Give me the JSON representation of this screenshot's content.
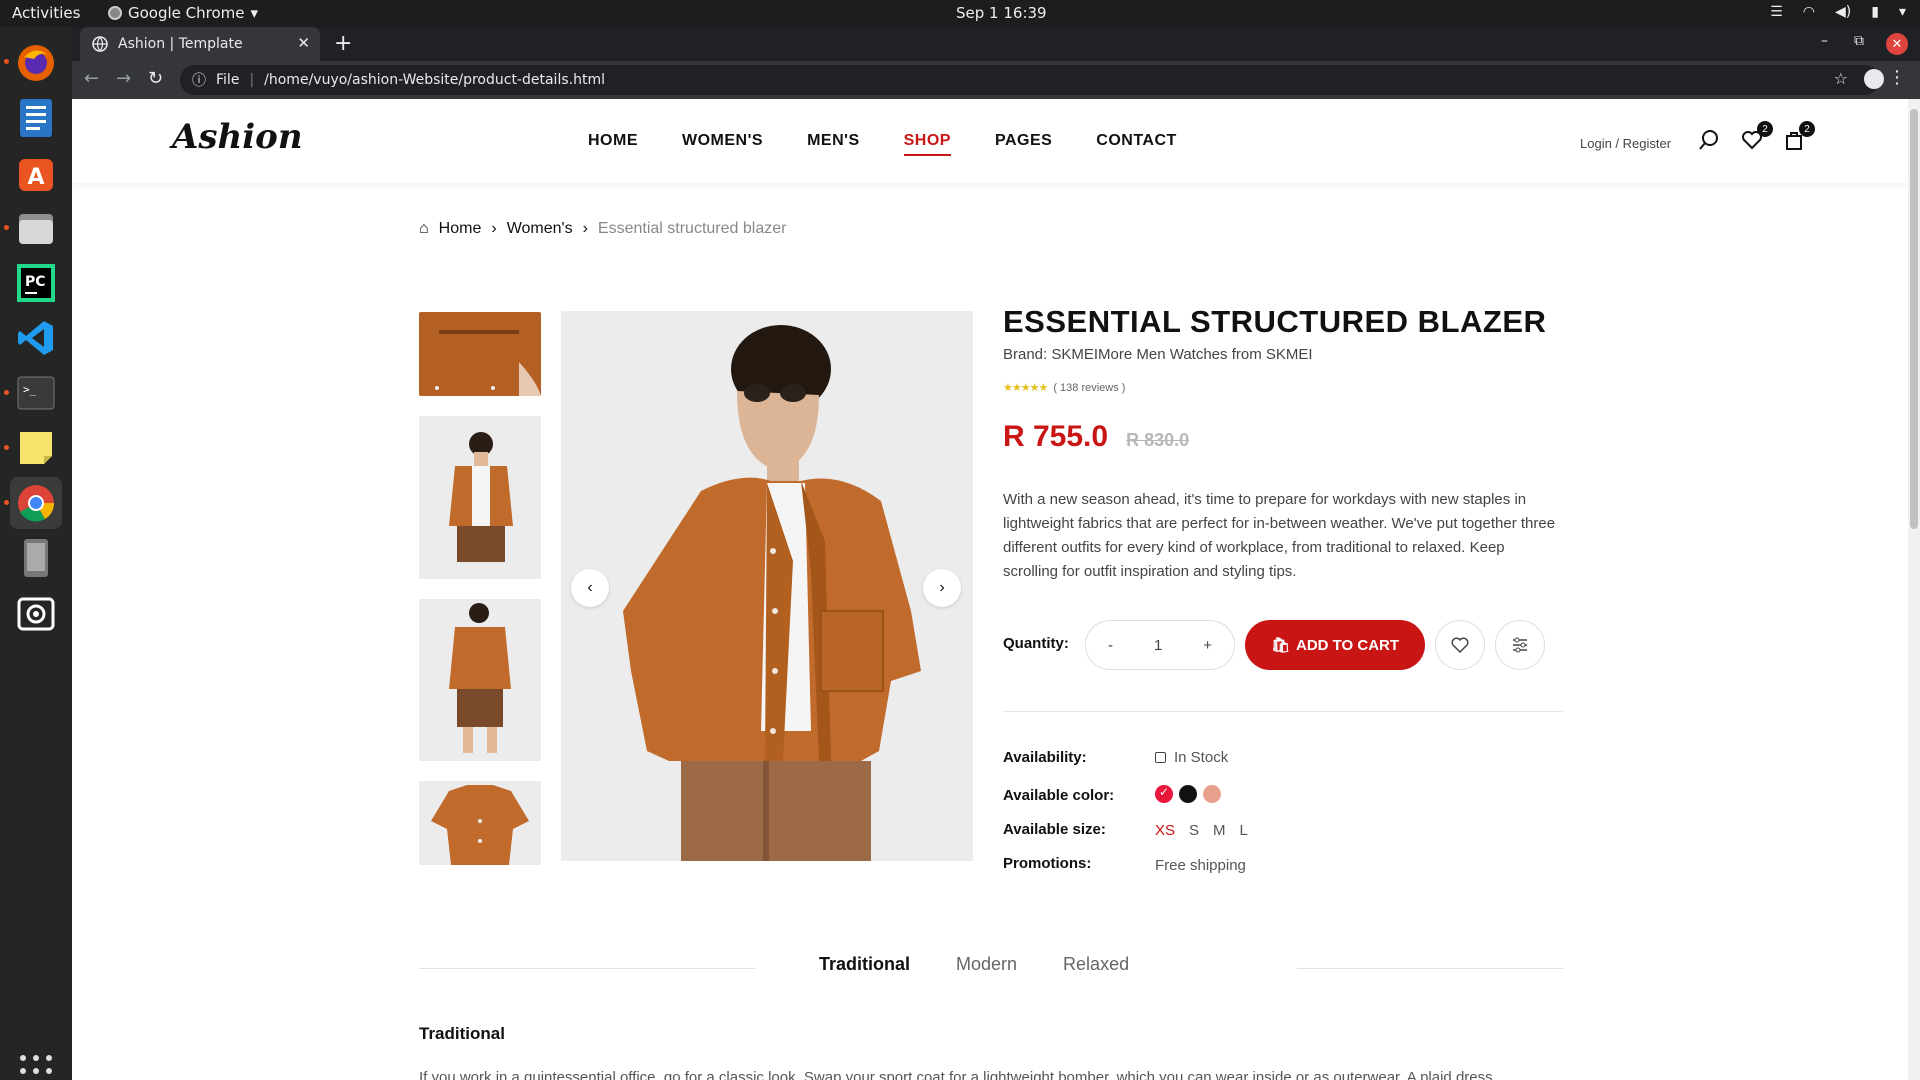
{
  "system": {
    "activities": "Activities",
    "app_name": "Google Chrome",
    "clock": "Sep 1  16:39"
  },
  "browser": {
    "tab_title": "Ashion | Template",
    "url_scheme": "File",
    "url": "/home/vuyo/ashion-Website/product-details.html"
  },
  "site": {
    "logo": "Ashion",
    "nav": [
      "HOME",
      "WOMEN'S",
      "MEN'S",
      "SHOP",
      "PAGES",
      "CONTACT"
    ],
    "nav_active": "SHOP",
    "auth": "Login / Register",
    "wishlist_count": "2",
    "cart_count": "2"
  },
  "breadcrumb": {
    "home": "Home",
    "category": "Women's",
    "current": "Essential structured blazer"
  },
  "product": {
    "title": "ESSENTIAL STRUCTURED BLAZER",
    "brand": "Brand: SKMEIMore Men Watches from SKMEI",
    "reviews": "( 138 reviews )",
    "rating": 5,
    "price": "R 755.0",
    "old_price": "R 830.0",
    "description": "With a new season ahead, it's time to prepare for workdays with new staples in lightweight fabrics that are perfect for in-between weather. We've put together three different outfits for every kind of workplace, from traditional to relaxed. Keep scrolling for outfit inspiration and styling tips.",
    "quantity_label": "Quantity:",
    "qty_minus": "-",
    "quantity": "1",
    "qty_plus": "+",
    "add_to_cart": "ADD TO CART",
    "availability_label": "Availability:",
    "availability": "In Stock",
    "color_label": "Available color:",
    "colors": [
      "#e8163b",
      "#111111",
      "#e7a08c"
    ],
    "size_label": "Available size:",
    "sizes": [
      "XS",
      "S",
      "M",
      "L"
    ],
    "selected_size": "XS",
    "promotions_label": "Promotions:",
    "promotions": "Free shipping",
    "shirt_color": "#c06a2b"
  },
  "tabs": {
    "items": [
      "Traditional",
      "Modern",
      "Relaxed"
    ],
    "selected": "Traditional",
    "content_title": "Traditional",
    "content_text": "If you work in a quintessential office, go for a classic look. Swap your sport coat for a lightweight bomber, which you can wear inside or as outerwear. A plaid dress"
  }
}
